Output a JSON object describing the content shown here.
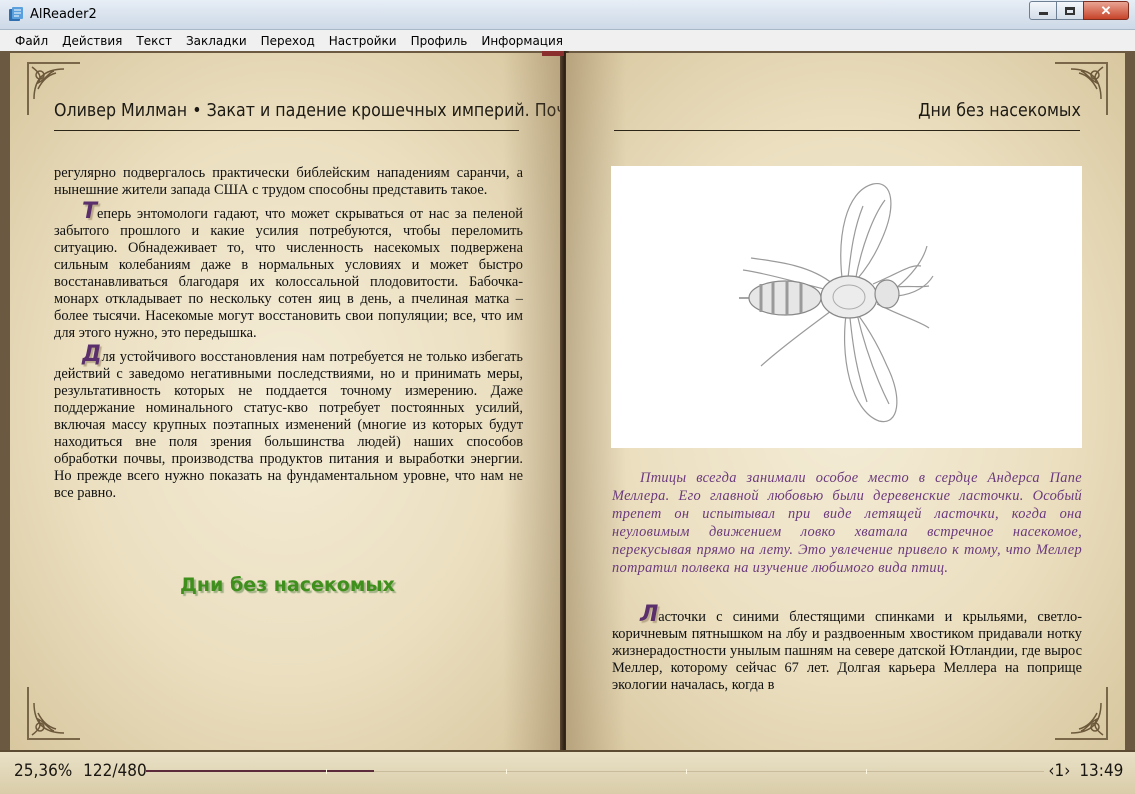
{
  "window": {
    "title": "AlReader2",
    "icon": "app-icon",
    "controls": [
      "minimize-icon",
      "maximize-icon",
      "close-icon"
    ]
  },
  "menu": {
    "items": [
      "Файл",
      "Действия",
      "Текст",
      "Закладки",
      "Переход",
      "Настройки",
      "Профиль",
      "Информация"
    ]
  },
  "left_page": {
    "header": "Оливер Милман • Закат и падение крошечных империй. Поч..",
    "paragraph1": "регулярно подвергалось практически библейским нападениям саранчи, а нынешние жители запада США с трудом способны представить такое.",
    "paragraph2_cap": "Т",
    "paragraph2": "еперь энтомологи гадают, что может скрываться от нас за пеленой забытого прошлого и какие усилия потребуются, чтобы переломить ситуацию. Обнадеживает то, что численность насекомых подвержена сильным колебаниям даже в нормальных условиях и может быстро восстанавливаться благодаря их колоссальной плодовитости. Бабочка-монарх откладывает по нескольку сотен яиц в день, а пчелиная матка – более тысячи. Насекомые могут восстановить свои популяции; все, что им для этого нужно, это передышка.",
    "paragraph3_cap": "Д",
    "paragraph3": "ля устойчивого восстановления нам потребуется не только избегать действий с заведомо негативными последствиями, но и принимать меры, результативность которых не поддается точному измерению. Даже поддержание номинального статус-кво потребует постоянных усилий, включая массу крупных поэтапных изменений (многие из которых будут находиться вне поля зрения большинства людей) наших способов обработки почвы, производства продуктов питания и выработки энергии. Но прежде всего нужно показать на фундаментальном уровне, что нам не все равно.",
    "chapter_title": "Дни без насекомых"
  },
  "right_page": {
    "header": "Дни без насекомых",
    "illustration": "wasp-illustration",
    "caption": "Птицы всегда занимали особое место в сердце Андерса Папе Меллера. Его главной любовью были деревенские ласточки. Особый трепет он испытывал при виде летящей ласточки, когда она неуловимым движением ловко хватала встречное насекомое, перекусывая прямо на лету. Это увлечение привело к тому, что Меллер потратил полвека на изучение любимого вида птиц.",
    "paragraph_cap": "Л",
    "paragraph": "асточки с синими блестящими спинками и крыльями, светло-коричневым пятнышком на лбу и раздвоенным хвостиком придавали нотку жизнерадостности унылым пашням на севере датской Ютландии, где вырос Меллер, которому сейчас 67 лет. Долгая карьера Меллера на поприще экологии началась, когда в"
  },
  "status": {
    "percent": "25,36%",
    "pages": "122/480",
    "progress": 0.2536,
    "page_indicator": "‹1›",
    "clock": "13:49"
  },
  "colors": {
    "dropcap": "#5a2f6c",
    "chapter_title": "#3f8f1d",
    "caption": "#6b3a7d",
    "progress": "#5b2b3c"
  }
}
